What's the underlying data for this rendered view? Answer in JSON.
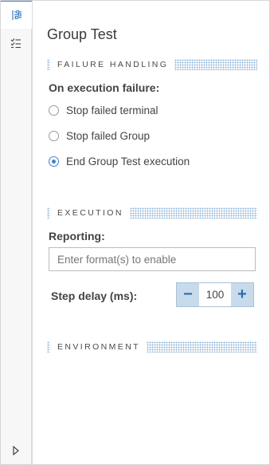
{
  "panel": {
    "title": "Group Test"
  },
  "failure_handling": {
    "heading": "FAILURE HANDLING",
    "label": "On execution failure:",
    "options": [
      {
        "label": "Stop failed terminal",
        "selected": false
      },
      {
        "label": "Stop failed Group",
        "selected": false
      },
      {
        "label": "End Group Test execution",
        "selected": true
      }
    ]
  },
  "execution": {
    "heading": "EXECUTION",
    "reporting_label": "Reporting:",
    "reporting_placeholder": "Enter format(s) to enable",
    "step_delay_label": "Step delay (ms):",
    "step_delay_value": "100",
    "decrement": "−",
    "increment": "+"
  },
  "environment": {
    "heading": "ENVIRONMENT"
  },
  "rail": {
    "icons": [
      "properties-icon",
      "checklist-icon",
      "expand-icon"
    ],
    "accent": "#3f82c4"
  },
  "colors": {
    "accent": "#3f82c4",
    "stepper_bg": "#c7dbed",
    "section_dots": "#8fb6d8"
  }
}
